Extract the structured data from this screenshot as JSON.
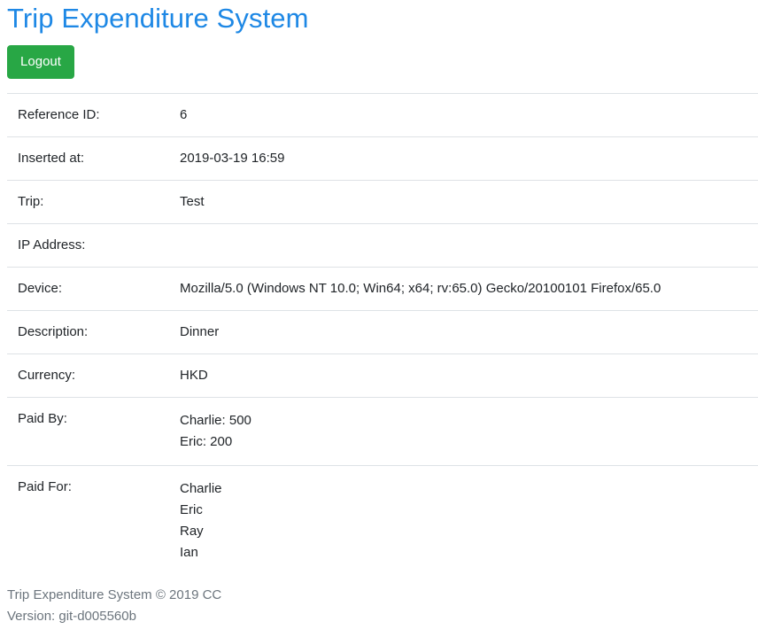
{
  "header": {
    "title": "Trip Expenditure System",
    "logout_label": "Logout"
  },
  "details": {
    "reference_id": {
      "label": "Reference ID:",
      "value": "6"
    },
    "inserted_at": {
      "label": "Inserted at:",
      "value": "2019-03-19 16:59"
    },
    "trip": {
      "label": "Trip:",
      "value": "Test"
    },
    "ip_address": {
      "label": "IP Address:",
      "value": ""
    },
    "device": {
      "label": "Device:",
      "value": "Mozilla/5.0 (Windows NT 10.0; Win64; x64; rv:65.0) Gecko/20100101 Firefox/65.0"
    },
    "description": {
      "label": "Description:",
      "value": "Dinner"
    },
    "currency": {
      "label": "Currency:",
      "value": "HKD"
    },
    "paid_by": {
      "label": "Paid By:",
      "entries": [
        "Charlie: 500",
        "Eric: 200"
      ]
    },
    "paid_for": {
      "label": "Paid For:",
      "entries": [
        "Charlie",
        "Eric",
        "Ray",
        "Ian"
      ]
    }
  },
  "footer": {
    "copyright": "Trip Expenditure System © 2019 CC",
    "version": "Version: git-d005560b"
  }
}
